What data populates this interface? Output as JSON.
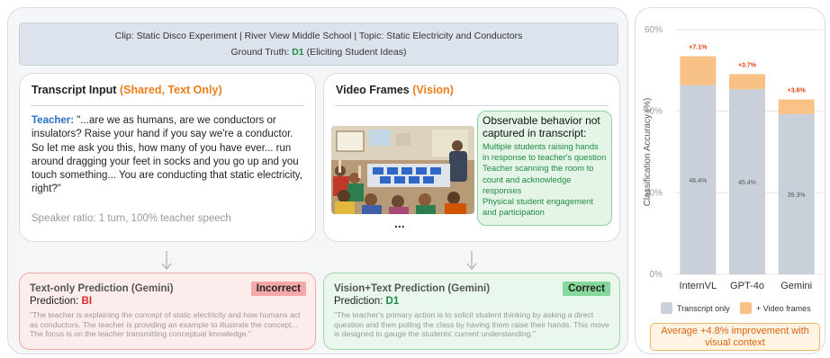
{
  "header": {
    "clip_line": "Clip: Static Disco Experiment | River View Middle School  |  Topic: Static Electricity and Conductors",
    "ground_truth_label": "Ground Truth:",
    "ground_truth_value": "D1",
    "ground_truth_desc": "(Eliciting Student Ideas)"
  },
  "transcript_card": {
    "title_main": "Transcript Input",
    "title_accent": "(Shared, Text Only)",
    "speaker": "Teacher:",
    "text": "\"...are we as humans, are we conductors or insulators? Raise your hand if you say we're a conductor. So let me ask you this, how many of you have ever... run around dragging your feet in socks and you go up and you touch something... You are conducting that static electricity, right?\"",
    "ratio": "Speaker ratio: 1 turn, 100% teacher speech"
  },
  "video_card": {
    "title_main": "Video Frames",
    "title_accent": "(Vision)",
    "ellipsis": "...",
    "observable_title": "Observable behavior not captured in transcript:",
    "observations": [
      "Multiple students raising hands in response to teacher's question",
      "Teacher scanning the room to count and acknowledge responses",
      "Physical student engagement and participation"
    ]
  },
  "text_prediction": {
    "title": "Text-only Prediction (Gemini)",
    "badge": "Incorrect",
    "label": "Prediction:",
    "value": "BI",
    "quote": "\"The teacher is explaining the concept of static electricity and how humans act as conductors. The teacher is providing an example to illustrate the concept... The focus is on the teacher transmitting conceptual knowledge.\""
  },
  "vision_prediction": {
    "title": "Vision+Text Prediction (Gemini)",
    "badge": "Correct",
    "label": "Prediction:",
    "value": "D1",
    "quote": "\"The teacher's primary action is to solicit student thinking by asking a direct question and then polling the class by having them raise their hands. This move is designed to gauge the students' current understanding.\""
  },
  "colors": {
    "transcript_bar": "#c9d0da",
    "video_bar": "#f8c186",
    "gain_label": "#e8420f",
    "correct": "#1f8a45",
    "incorrect": "#d62b2b",
    "accent": "#ef7d1a"
  },
  "chart_data": {
    "type": "bar",
    "stacked": true,
    "categories": [
      "InternVL",
      "GPT-4o",
      "Gemini"
    ],
    "series": [
      {
        "name": "Transcript only",
        "values": [
          46.4,
          45.4,
          39.3
        ]
      },
      {
        "name": "+ Video frames",
        "values": [
          7.1,
          3.7,
          3.6
        ]
      }
    ],
    "bar_labels": [
      "46.4%",
      "45.4%",
      "39.3%"
    ],
    "gain_labels": [
      "+7.1%",
      "+3.7%",
      "+3.6%"
    ],
    "ylabel": "Classification Accuracy (%)",
    "ylim": [
      0,
      60
    ],
    "yticks": [
      0,
      20,
      40,
      60
    ],
    "ytick_labels": [
      "0%",
      "20%",
      "40%",
      "60%"
    ],
    "grid": true,
    "legend_position": "bottom"
  },
  "callout": "Average +4.8% improvement with visual context"
}
